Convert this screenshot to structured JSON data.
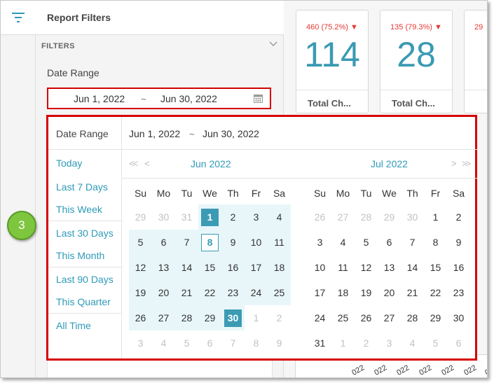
{
  "panel": {
    "title": "Report Filters",
    "filters_label": "FILTERS",
    "date_range_label": "Date Range",
    "date_from": "Jun 1, 2022",
    "date_sep": "~",
    "date_to": "Jun 30, 2022"
  },
  "cards": [
    {
      "delta": "460 (75.2%)",
      "value": "114",
      "label": "Total Ch..."
    },
    {
      "delta": "135 (79.3%)",
      "value": "28",
      "label": "Total Ch..."
    },
    {
      "delta": "29",
      "value": "",
      "label": ""
    }
  ],
  "bottom_ticks": [
    "022",
    "022",
    "022",
    "022",
    "022",
    "022",
    "022"
  ],
  "popup": {
    "presets_header": "Date Range",
    "presets": [
      "Today",
      "Last 7 Days",
      "This Week",
      "Last 30 Days",
      "This Month",
      "Last 90 Days",
      "This Quarter",
      "All Time"
    ],
    "range_from": "Jun 1, 2022",
    "range_sep": "~",
    "range_to": "Jun 30, 2022",
    "nav": {
      "prev_year": "<<",
      "prev_month": "<",
      "next_month": ">",
      "next_year": ">>"
    },
    "weekdays": [
      "Su",
      "Mo",
      "Tu",
      "We",
      "Th",
      "Fr",
      "Sa"
    ],
    "months": [
      {
        "title": "Jun 2022",
        "weeks": [
          [
            "29",
            "30",
            "31",
            "1",
            "2",
            "3",
            "4"
          ],
          [
            "5",
            "6",
            "7",
            "8",
            "9",
            "10",
            "11"
          ],
          [
            "12",
            "13",
            "14",
            "15",
            "16",
            "17",
            "18"
          ],
          [
            "19",
            "20",
            "21",
            "22",
            "23",
            "24",
            "25"
          ],
          [
            "26",
            "27",
            "28",
            "29",
            "30",
            "1",
            "2"
          ],
          [
            "3",
            "4",
            "5",
            "6",
            "7",
            "8",
            "9"
          ]
        ],
        "in_month_start": 3,
        "in_month_end": 32,
        "range_start": 3,
        "range_end": 32,
        "selected": [
          3,
          32
        ],
        "today": 10
      },
      {
        "title": "Jul 2022",
        "weeks": [
          [
            "26",
            "27",
            "28",
            "29",
            "30",
            "1",
            "2"
          ],
          [
            "3",
            "4",
            "5",
            "6",
            "7",
            "8",
            "9"
          ],
          [
            "10",
            "11",
            "12",
            "13",
            "14",
            "15",
            "16"
          ],
          [
            "17",
            "18",
            "19",
            "20",
            "21",
            "22",
            "23"
          ],
          [
            "24",
            "25",
            "26",
            "27",
            "28",
            "29",
            "30"
          ],
          [
            "31",
            "1",
            "2",
            "3",
            "4",
            "5",
            "6"
          ]
        ],
        "in_month_start": 5,
        "in_month_end": 35
      }
    ]
  },
  "step_badge": "3",
  "colors": {
    "accent": "#2e9ab8",
    "highlight": "#d60000",
    "range": "#e8f6f9",
    "badge": "#7ec63e",
    "delta": "#e53935"
  }
}
